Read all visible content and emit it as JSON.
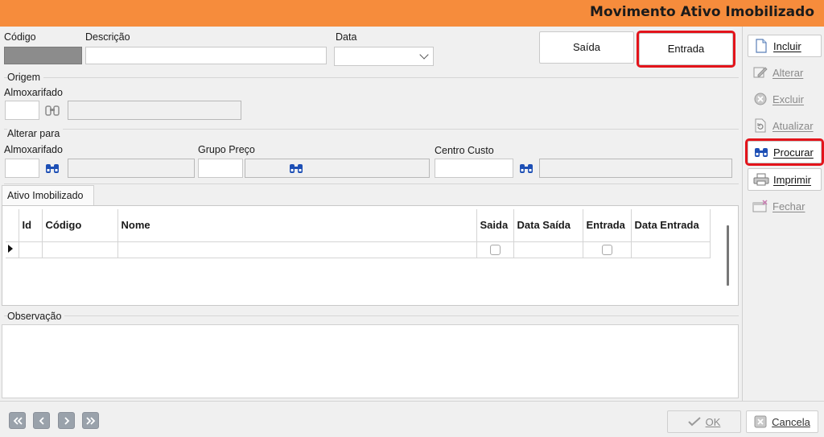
{
  "window": {
    "title": "Movimento Ativo Imobilizado"
  },
  "header": {
    "codigo_label": "Código",
    "descricao_label": "Descrição",
    "data_label": "Data",
    "codigo_value": "",
    "descricao_value": "",
    "data_value": "",
    "saida_button": "Saída",
    "entrada_button": "Entrada"
  },
  "origem": {
    "title": "Origem",
    "almox_label": "Almoxarifado"
  },
  "alterar": {
    "title": "Alterar para",
    "almox_label": "Almoxarifado",
    "grupo_label": "Grupo Preço",
    "centro_label": "Centro Custo"
  },
  "tab": {
    "label": "Ativo Imobilizado"
  },
  "grid": {
    "columns": [
      "Id",
      "Código",
      "Nome",
      "Saida",
      "Data Saída",
      "Entrada",
      "Data Entrada"
    ],
    "rows": [
      {
        "id": "",
        "codigo": "",
        "nome": "",
        "saida": false,
        "data_saida": "",
        "entrada": false,
        "data_entrada": ""
      }
    ]
  },
  "observacao": {
    "label": "Observação"
  },
  "toolbar": {
    "incluir": "Incluir",
    "alterar": "Alterar",
    "excluir": "Excluir",
    "atualizar": "Atualizar",
    "procurar": "Procurar",
    "imprimir": "Imprimir",
    "fechar": "Fechar"
  },
  "footer": {
    "ok": "OK",
    "cancela": "Cancela"
  },
  "colors": {
    "title_bar": "#f68c3c",
    "highlight": "#e3141b",
    "accent_blue": "#1d4fb5"
  }
}
